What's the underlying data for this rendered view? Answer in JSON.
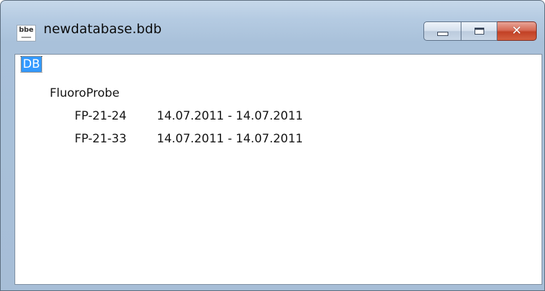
{
  "window": {
    "title": "newdatabase.bdb",
    "icon_text": "bbe",
    "icon_name": "bbe-app-icon",
    "caption_buttons": {
      "minimize_icon": "minimize-icon",
      "maximize_icon": "maximize-icon",
      "close_glyph": "✕"
    }
  },
  "tree": {
    "root": {
      "label": "DB",
      "selected": true
    },
    "instrument": {
      "label": "FluoroProbe"
    },
    "files": [
      {
        "id": "FP-21-24",
        "range": "14.07.2011 - 14.07.2011"
      },
      {
        "id": "FP-21-33",
        "range": "14.07.2011 - 14.07.2011"
      }
    ]
  },
  "colors": {
    "selection": "#3399ff",
    "close_button": "#c24126",
    "frame": "#a9c1da"
  }
}
